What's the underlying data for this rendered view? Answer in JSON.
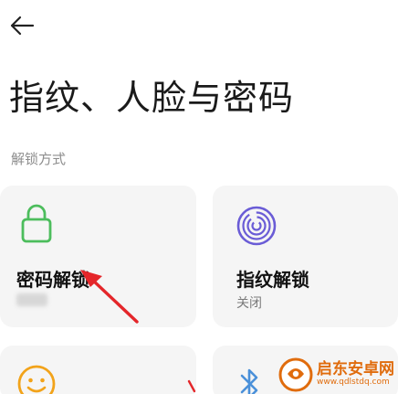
{
  "header": {
    "back_icon": "arrow-left-icon",
    "title": "指纹、人脸与密码"
  },
  "section": {
    "label": "解锁方式"
  },
  "cards": [
    {
      "icon": "lock-icon",
      "title": "密码解锁",
      "subtitle": "",
      "subtitle_blurred": true,
      "accent": "#4cbd5c"
    },
    {
      "icon": "fingerprint-icon",
      "title": "指纹解锁",
      "subtitle": "关闭",
      "accent": "#6a5cd6"
    },
    {
      "icon": "face-icon",
      "title": "",
      "subtitle": "",
      "accent": "#f2a31a"
    },
    {
      "icon": "bluetooth-icon",
      "title": "",
      "subtitle": "",
      "accent": "#4a90d9"
    }
  ],
  "annotation": {
    "color": "#e4262a",
    "pointer": "red-arrow"
  },
  "watermark": {
    "name": "启东安卓网",
    "url": "www.qdlstdq.com",
    "color": "#e06c0d"
  }
}
